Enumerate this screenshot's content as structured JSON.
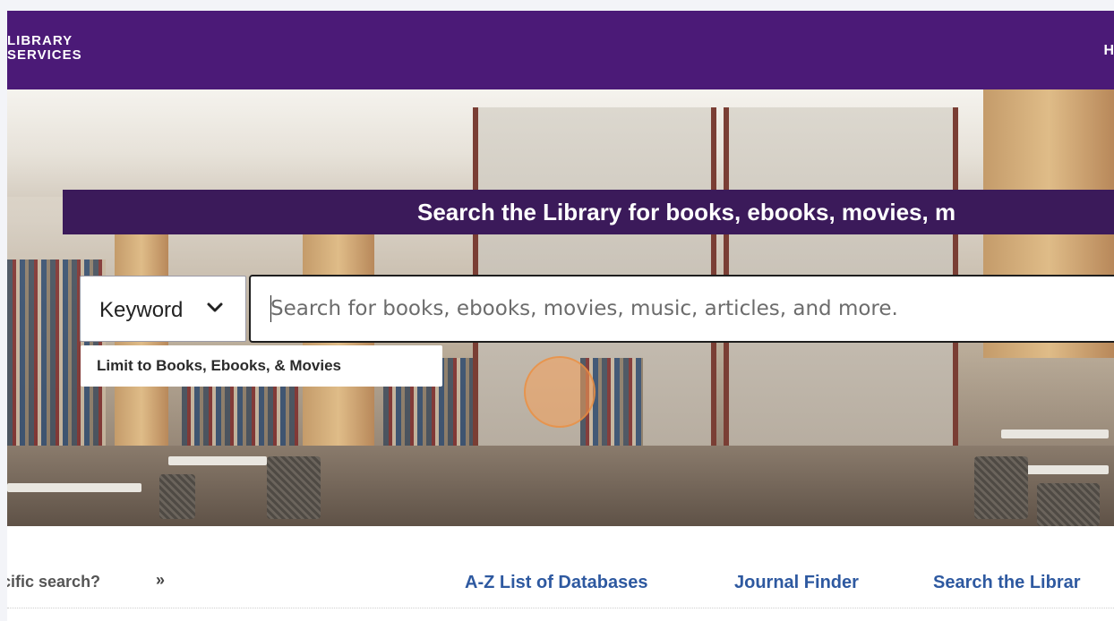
{
  "header": {
    "logo_line1": "LIBRARY",
    "logo_line2": "SERVICES",
    "nav_right_partial": "H"
  },
  "hero": {
    "banner_title": "Search the Library for books, ebooks, movies, m",
    "search": {
      "keyword_select_value": "Keyword",
      "placeholder": "Search for books, ebooks, movies, music, articles, and more."
    },
    "limit_option": "Limit to Books, Ebooks, & Movies"
  },
  "bottom_links": {
    "specific_search": "cific search?",
    "specific_icon": "double-chevron-right",
    "az_databases": "A-Z List of Databases",
    "journal_finder": "Journal Finder",
    "search_library": "Search the Librar"
  },
  "colors": {
    "header_bg": "#4b1a77",
    "banner_bg": "#3b1a5a",
    "link": "#2e59a0"
  }
}
